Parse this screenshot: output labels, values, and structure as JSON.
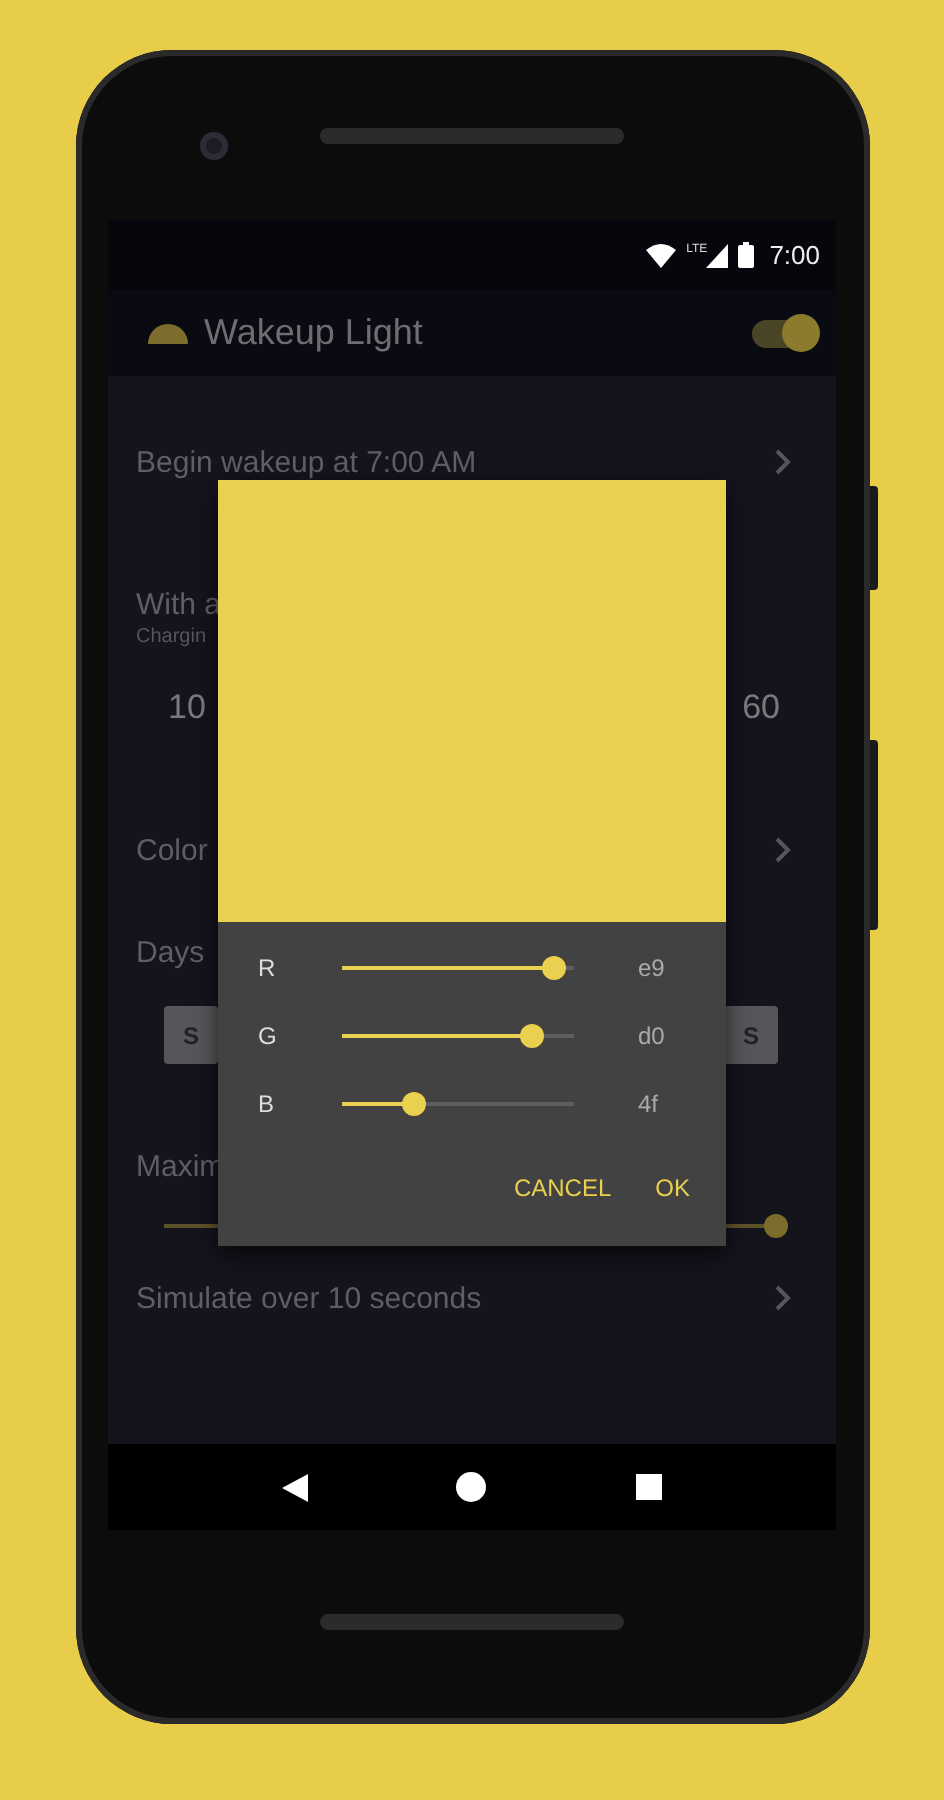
{
  "status_bar": {
    "network": "LTE",
    "time": "7:00"
  },
  "app_bar": {
    "title": "Wakeup Light",
    "on": true
  },
  "settings": [
    {
      "kind": "link",
      "label": "Begin wakeup at 7:00 AM"
    },
    {
      "kind": "range",
      "label": "With a",
      "sublabel": "Chargin",
      "min": "10",
      "max": "60"
    },
    {
      "kind": "link",
      "label": "Color"
    },
    {
      "kind": "days",
      "label": "Days",
      "days": [
        {
          "label": "S",
          "selected": true
        },
        {
          "label": "S",
          "selected": true
        }
      ]
    },
    {
      "kind": "slider",
      "label": "Maxim",
      "level": 1
    },
    {
      "kind": "link",
      "label": "Simulate over 10 seconds"
    }
  ],
  "color_dialog": {
    "channels": [
      {
        "name": "R",
        "level": 0.914,
        "value": "e9"
      },
      {
        "name": "G",
        "level": 0.816,
        "value": "d0"
      },
      {
        "name": "B",
        "level": 0.31,
        "value": "4f"
      }
    ],
    "buttons": [
      "CANCEL",
      "OK"
    ]
  }
}
